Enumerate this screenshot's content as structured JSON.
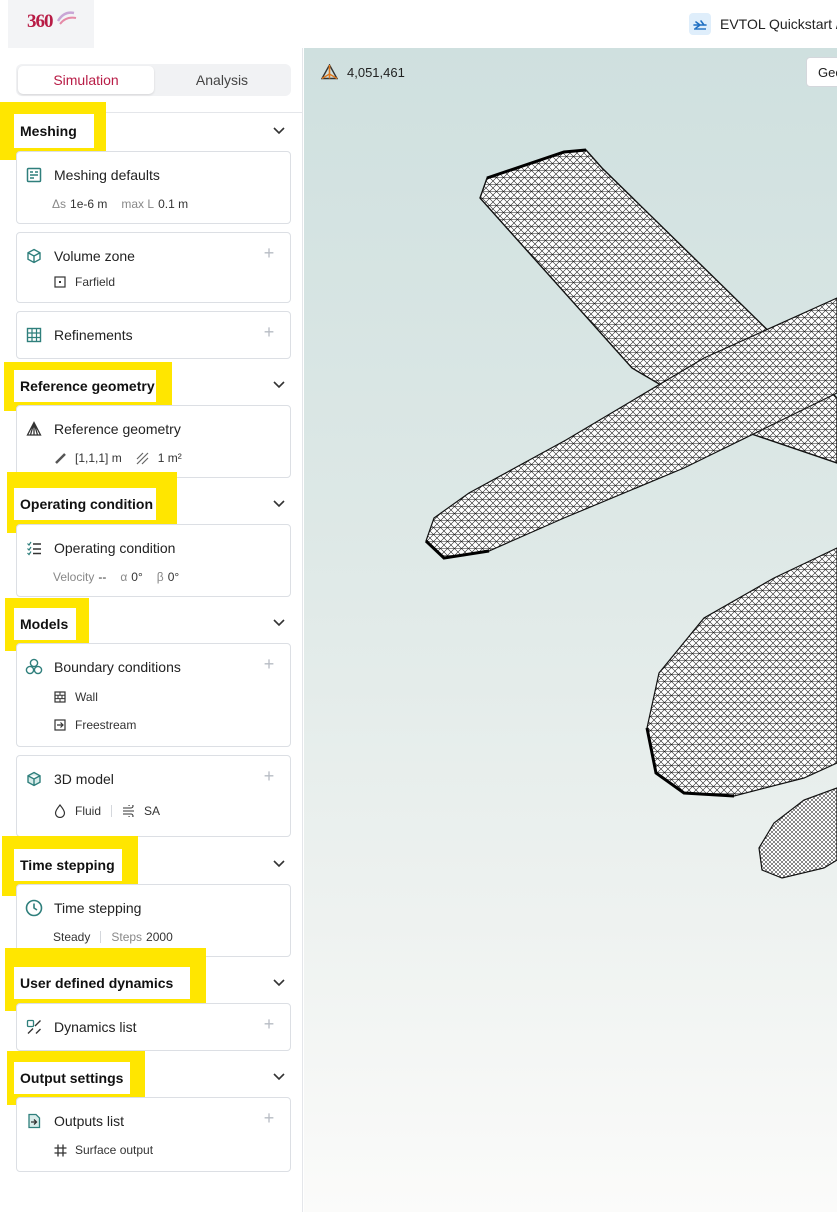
{
  "app": {
    "logo_text": "360",
    "project_name": "EVTOL Quickstart /"
  },
  "tabs": {
    "simulation": "Simulation",
    "analysis": "Analysis"
  },
  "viewport": {
    "cell_count": "4,051,461",
    "geometry_button": "Geo"
  },
  "sections": {
    "meshing": {
      "title": "Meshing",
      "defaults": {
        "title": "Meshing defaults",
        "ds_label": "Δs",
        "ds_value": "1e-6 m",
        "maxl_label": "max L",
        "maxl_value": "0.1 m"
      },
      "volume_zone": {
        "title": "Volume zone",
        "item": "Farfield"
      },
      "refinements": {
        "title": "Refinements"
      }
    },
    "reference_geometry": {
      "title": "Reference geometry",
      "card": {
        "title": "Reference geometry",
        "length": "[1,1,1] m",
        "area": "1 m²"
      }
    },
    "operating_condition": {
      "title": "Operating condition",
      "card": {
        "title": "Operating condition",
        "velocity_label": "Velocity",
        "velocity_value": "--",
        "alpha_label": "α",
        "alpha_value": "0°",
        "beta_label": "β",
        "beta_value": "0°"
      }
    },
    "models": {
      "title": "Models",
      "boundary": {
        "title": "Boundary conditions",
        "items": [
          "Wall",
          "Freestream"
        ]
      },
      "model3d": {
        "title": "3D model",
        "fluid": "Fluid",
        "turbulence": "SA"
      }
    },
    "time_stepping": {
      "title": "Time stepping",
      "card": {
        "title": "Time stepping",
        "mode": "Steady",
        "steps_label": "Steps",
        "steps_value": "2000"
      }
    },
    "user_dynamics": {
      "title": "User defined dynamics",
      "card": {
        "title": "Dynamics list"
      }
    },
    "output_settings": {
      "title": "Output settings",
      "card": {
        "title": "Outputs list",
        "item": "Surface output"
      }
    }
  },
  "colors": {
    "accent": "#b81c46",
    "highlight": "#ffe600",
    "icon_teal": "#2f7f7c"
  }
}
